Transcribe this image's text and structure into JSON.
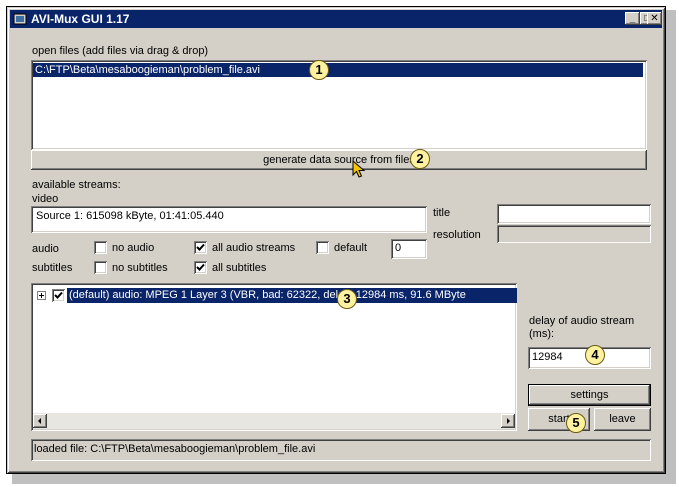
{
  "window": {
    "title": "AVI-Mux GUI 1.17",
    "minimize": "_",
    "maximize": "□",
    "close": "✕"
  },
  "files": {
    "label": "open files (add files via drag & drop)",
    "items": [
      "C:\\FTP\\Beta\\mesaboogieman\\problem_file.avi"
    ],
    "generate_button": "generate data source from files"
  },
  "streams": {
    "label": "available streams:",
    "video_label": "video",
    "video_value": "Source 1: 615098 kByte, 01:41:05.440",
    "title_label": "title",
    "title_value": "",
    "resolution_label": "resolution",
    "resolution_value": "",
    "audio_label": "audio",
    "no_audio": "no audio",
    "all_audio_streams": "all audio streams",
    "default": "default",
    "default_value": "0",
    "subtitles_label": "subtitles",
    "no_subtitles": "no subtitles",
    "all_subtitles": "all subtitles",
    "checks": {
      "no_audio": false,
      "all_audio": true,
      "default": false,
      "no_subtitles": false,
      "all_subtitles": true
    },
    "tree_items": [
      "(default) audio: MPEG 1 Layer 3 (VBR, bad: 62322, delay: 12984 ms, 91.6 MByte"
    ]
  },
  "delay": {
    "label_line1": "delay of audio stream",
    "label_line2": "(ms):",
    "value": "12984"
  },
  "buttons": {
    "settings": "settings",
    "start": "start",
    "leave": "leave"
  },
  "status": {
    "text": "loaded file: C:\\FTP\\Beta\\mesaboogieman\\problem_file.avi"
  },
  "callouts": [
    "1",
    "2",
    "3",
    "4",
    "5"
  ],
  "colors": {
    "selection": "#0a246a",
    "face": "#d4d0c8",
    "callout": "#fef2a0"
  }
}
